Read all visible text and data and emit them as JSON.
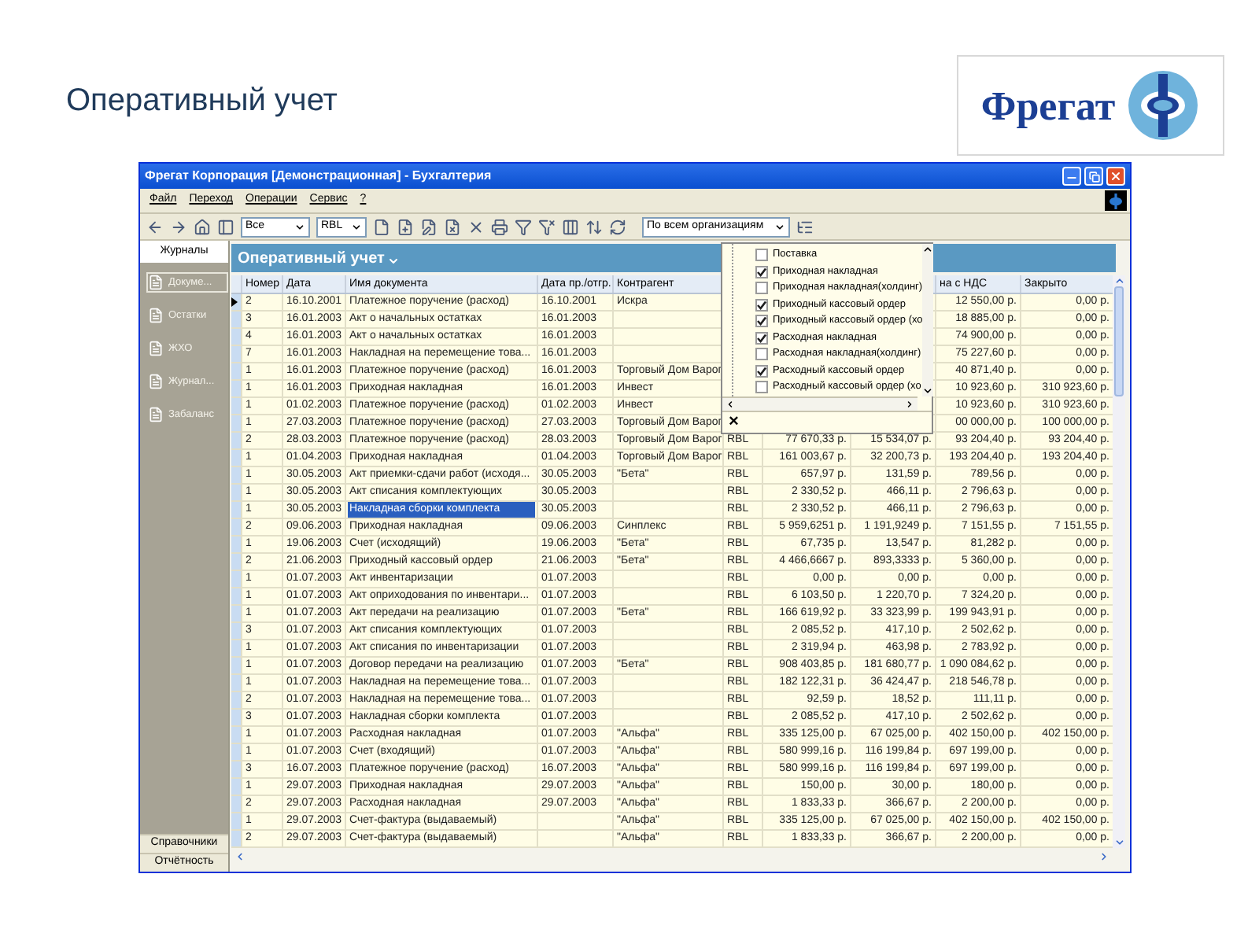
{
  "slide_title": "Оперативный учет",
  "logo": {
    "text": "Фрегат"
  },
  "window": {
    "title": "Фрегат Корпорация [Демонстрационная] - Бухгалтерия"
  },
  "menu": [
    "Файл",
    "Переход",
    "Операции",
    "Сервис",
    "?"
  ],
  "toolbar": {
    "filter_combo": "Все",
    "currency_combo": "RBL",
    "organization_combo": "По всем организациям"
  },
  "sidebar": {
    "header": "Журналы",
    "items": [
      {
        "label": "Докуме...",
        "selected": true
      },
      {
        "label": "Остатки",
        "selected": false
      },
      {
        "label": "ЖХО",
        "selected": false
      },
      {
        "label": "Журнал...",
        "selected": false
      },
      {
        "label": "Забаланс",
        "selected": false
      }
    ],
    "bottom_buttons": [
      "Справочники",
      "Отчётность"
    ]
  },
  "panel_title": "Оперативный учет",
  "table": {
    "columns": [
      "Номер",
      "Дата",
      "Имя документа",
      "Дата пр./отгр.",
      "Контрагент",
      null,
      null,
      null,
      "на с НДС",
      "Закрыто"
    ],
    "rows": [
      {
        "current": true,
        "selected": false,
        "cells": [
          "2",
          "16.10.2001",
          "Платежное поручение (расход)",
          "16.10.2001",
          "Искра",
          null,
          null,
          null,
          "12 550,00 р.",
          "0,00 р."
        ]
      },
      {
        "current": false,
        "selected": false,
        "cells": [
          "3",
          "16.01.2003",
          "Акт о начальных остатках",
          "16.01.2003",
          "",
          null,
          null,
          null,
          "18 885,00 р.",
          "0,00 р."
        ]
      },
      {
        "current": false,
        "selected": false,
        "cells": [
          "4",
          "16.01.2003",
          "Акт о начальных остатках",
          "16.01.2003",
          "",
          null,
          null,
          null,
          "74 900,00 р.",
          "0,00 р."
        ]
      },
      {
        "current": false,
        "selected": false,
        "cells": [
          "7",
          "16.01.2003",
          "Накладная на перемещение това...",
          "16.01.2003",
          "",
          null,
          null,
          null,
          "75 227,60 р.",
          "0,00 р."
        ]
      },
      {
        "current": false,
        "selected": false,
        "cells": [
          "1",
          "16.01.2003",
          "Платежное поручение (расход)",
          "16.01.2003",
          "Торговый Дом Варог",
          null,
          null,
          null,
          "40 871,40 р.",
          "0,00 р."
        ]
      },
      {
        "current": false,
        "selected": false,
        "cells": [
          "1",
          "16.01.2003",
          "Приходная накладная",
          "16.01.2003",
          "Инвест",
          null,
          null,
          null,
          "10 923,60 р.",
          "310 923,60 р."
        ]
      },
      {
        "current": false,
        "selected": false,
        "cells": [
          "1",
          "01.02.2003",
          "Платежное поручение (расход)",
          "01.02.2003",
          "Инвест",
          null,
          null,
          null,
          "10 923,60 р.",
          "310 923,60 р."
        ]
      },
      {
        "current": false,
        "selected": false,
        "cells": [
          "1",
          "27.03.2003",
          "Платежное поручение (расход)",
          "27.03.2003",
          "Торговый Дом Варог",
          null,
          null,
          null,
          "00 000,00 р.",
          "100 000,00 р."
        ]
      },
      {
        "current": false,
        "selected": false,
        "cells": [
          "2",
          "28.03.2003",
          "Платежное поручение (расход)",
          "28.03.2003",
          "Торговый Дом Варог",
          "RBL",
          "77 670,33 р.",
          "15 534,07 р.",
          "93 204,40 р.",
          "93 204,40 р."
        ]
      },
      {
        "current": false,
        "selected": false,
        "cells": [
          "1",
          "01.04.2003",
          "Приходная накладная",
          "01.04.2003",
          "Торговый Дом Варог",
          "RBL",
          "161 003,67 р.",
          "32 200,73 р.",
          "193 204,40 р.",
          "193 204,40 р."
        ]
      },
      {
        "current": false,
        "selected": false,
        "cells": [
          "1",
          "30.05.2003",
          "Акт приемки-сдачи работ (исходя...",
          "30.05.2003",
          "\"Бета\"",
          "RBL",
          "657,97 р.",
          "131,59 р.",
          "789,56 р.",
          "0,00 р."
        ]
      },
      {
        "current": false,
        "selected": false,
        "cells": [
          "1",
          "30.05.2003",
          "Акт списания комплектующих",
          "30.05.2003",
          "",
          "RBL",
          "2 330,52 р.",
          "466,11 р.",
          "2 796,63 р.",
          "0,00 р."
        ]
      },
      {
        "current": false,
        "selected": true,
        "cells": [
          "1",
          "30.05.2003",
          "Накладная сборки комплекта",
          "30.05.2003",
          "",
          "RBL",
          "2 330,52 р.",
          "466,11 р.",
          "2 796,63 р.",
          "0,00 р."
        ]
      },
      {
        "current": false,
        "selected": false,
        "cells": [
          "2",
          "09.06.2003",
          "Приходная накладная",
          "09.06.2003",
          "Синплекс",
          "RBL",
          "5 959,6251 р.",
          "1 191,9249 р.",
          "7 151,55 р.",
          "7 151,55 р."
        ]
      },
      {
        "current": false,
        "selected": false,
        "cells": [
          "1",
          "19.06.2003",
          "Счет (исходящий)",
          "19.06.2003",
          "\"Бета\"",
          "RBL",
          "67,735 р.",
          "13,547 р.",
          "81,282 р.",
          "0,00 р."
        ]
      },
      {
        "current": false,
        "selected": false,
        "cells": [
          "2",
          "21.06.2003",
          "Приходный кассовый ордер",
          "21.06.2003",
          "\"Бета\"",
          "RBL",
          "4 466,6667 р.",
          "893,3333 р.",
          "5 360,00 р.",
          "0,00 р."
        ]
      },
      {
        "current": false,
        "selected": false,
        "cells": [
          "1",
          "01.07.2003",
          "Акт инвентаризации",
          "01.07.2003",
          "",
          "RBL",
          "0,00 р.",
          "0,00 р.",
          "0,00 р.",
          "0,00 р."
        ]
      },
      {
        "current": false,
        "selected": false,
        "cells": [
          "1",
          "01.07.2003",
          "Акт оприходования по инвентари...",
          "01.07.2003",
          "",
          "RBL",
          "6 103,50 р.",
          "1 220,70 р.",
          "7 324,20 р.",
          "0,00 р."
        ]
      },
      {
        "current": false,
        "selected": false,
        "cells": [
          "1",
          "01.07.2003",
          "Акт передачи на реализацию",
          "01.07.2003",
          "\"Бета\"",
          "RBL",
          "166 619,92 р.",
          "33 323,99 р.",
          "199 943,91 р.",
          "0,00 р."
        ]
      },
      {
        "current": false,
        "selected": false,
        "cells": [
          "3",
          "01.07.2003",
          "Акт списания комплектующих",
          "01.07.2003",
          "",
          "RBL",
          "2 085,52 р.",
          "417,10 р.",
          "2 502,62 р.",
          "0,00 р."
        ]
      },
      {
        "current": false,
        "selected": false,
        "cells": [
          "1",
          "01.07.2003",
          "Акт списания по инвентаризации",
          "01.07.2003",
          "",
          "RBL",
          "2 319,94 р.",
          "463,98 р.",
          "2 783,92 р.",
          "0,00 р."
        ]
      },
      {
        "current": false,
        "selected": false,
        "cells": [
          "1",
          "01.07.2003",
          "Договор передачи на реализацию",
          "01.07.2003",
          "\"Бета\"",
          "RBL",
          "908 403,85 р.",
          "181 680,77 р.",
          "1 090 084,62 р.",
          "0,00 р."
        ]
      },
      {
        "current": false,
        "selected": false,
        "cells": [
          "1",
          "01.07.2003",
          "Накладная на перемещение това...",
          "01.07.2003",
          "",
          "RBL",
          "182 122,31 р.",
          "36 424,47 р.",
          "218 546,78 р.",
          "0,00 р."
        ]
      },
      {
        "current": false,
        "selected": false,
        "cells": [
          "2",
          "01.07.2003",
          "Накладная на перемещение това...",
          "01.07.2003",
          "",
          "RBL",
          "92,59 р.",
          "18,52 р.",
          "111,11 р.",
          "0,00 р."
        ]
      },
      {
        "current": false,
        "selected": false,
        "cells": [
          "3",
          "01.07.2003",
          "Накладная сборки комплекта",
          "01.07.2003",
          "",
          "RBL",
          "2 085,52 р.",
          "417,10 р.",
          "2 502,62 р.",
          "0,00 р."
        ]
      },
      {
        "current": false,
        "selected": false,
        "cells": [
          "1",
          "01.07.2003",
          "Расходная накладная",
          "01.07.2003",
          "\"Альфа\"",
          "RBL",
          "335 125,00 р.",
          "67 025,00 р.",
          "402 150,00 р.",
          "402 150,00 р."
        ]
      },
      {
        "current": false,
        "selected": false,
        "cells": [
          "1",
          "01.07.2003",
          "Счет (входящий)",
          "01.07.2003",
          "\"Альфа\"",
          "RBL",
          "580 999,16 р.",
          "116 199,84 р.",
          "697 199,00 р.",
          "0,00 р."
        ]
      },
      {
        "current": false,
        "selected": false,
        "cells": [
          "3",
          "16.07.2003",
          "Платежное поручение (расход)",
          "16.07.2003",
          "\"Альфа\"",
          "RBL",
          "580 999,16 р.",
          "116 199,84 р.",
          "697 199,00 р.",
          "0,00 р."
        ]
      },
      {
        "current": false,
        "selected": false,
        "cells": [
          "1",
          "29.07.2003",
          "Приходная накладная",
          "29.07.2003",
          "\"Альфа\"",
          "RBL",
          "150,00 р.",
          "30,00 р.",
          "180,00 р.",
          "0,00 р."
        ]
      },
      {
        "current": false,
        "selected": false,
        "cells": [
          "2",
          "29.07.2003",
          "Расходная накладная",
          "29.07.2003",
          "\"Альфа\"",
          "RBL",
          "1 833,33 р.",
          "366,67 р.",
          "2 200,00 р.",
          "0,00 р."
        ]
      },
      {
        "current": false,
        "selected": false,
        "cells": [
          "1",
          "29.07.2003",
          "Счет-фактура (выдаваемый)",
          "",
          "\"Альфа\"",
          "RBL",
          "335 125,00 р.",
          "67 025,00 р.",
          "402 150,00 р.",
          "402 150,00 р."
        ]
      },
      {
        "current": false,
        "selected": false,
        "cells": [
          "2",
          "29.07.2003",
          "Счет-фактура (выдаваемый)",
          "",
          "\"Альфа\"",
          "RBL",
          "1 833,33 р.",
          "366,67 р.",
          "2 200,00 р.",
          "0,00 р."
        ]
      }
    ]
  },
  "filter_dropdown": {
    "items": [
      {
        "label": "Поставка",
        "checked": false
      },
      {
        "label": "Приходная накладная",
        "checked": true
      },
      {
        "label": "Приходная накладная(холдинг)",
        "checked": false
      },
      {
        "label": "Приходный кассовый ордер",
        "checked": true
      },
      {
        "label": "Приходный кассовый ордер (хо",
        "checked": true
      },
      {
        "label": "Расходная накладная",
        "checked": true
      },
      {
        "label": "Расходная накладная(холдинг)",
        "checked": false
      },
      {
        "label": "Расходный кассовый ордер",
        "checked": true
      },
      {
        "label": "Расходный кассовый ордер (хо",
        "checked": false
      }
    ],
    "close_button": "×"
  }
}
